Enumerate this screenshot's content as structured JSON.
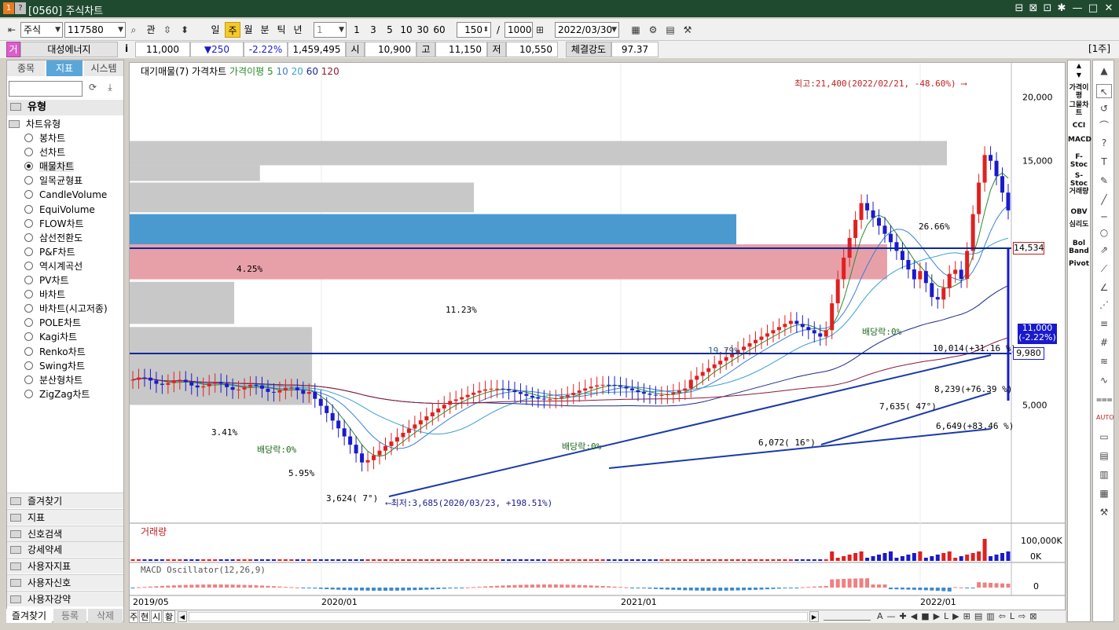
{
  "title_bar": {
    "icons": [
      "1",
      "?"
    ],
    "title": "[0560] 주식차트"
  },
  "toolbar": {
    "market": "주식",
    "code": "117580",
    "btn_gwan": "관",
    "periods": [
      "일",
      "주",
      "월",
      "분",
      "틱",
      "년"
    ],
    "active_period": "주",
    "interval_value": "1",
    "nums": [
      "1",
      "3",
      "5",
      "10",
      "30",
      "60"
    ],
    "count_value": "150",
    "slash": "/",
    "max_value": "1000",
    "date_value": "2022/03/30"
  },
  "quote": {
    "badge": "거",
    "name": "대성에너지",
    "info": "i",
    "price": "11,000",
    "change": "▼250",
    "rate": "-2.22%",
    "volume": "1,459,495",
    "open_label": "시",
    "open": "10,900",
    "high_label": "고",
    "high": "11,150",
    "low_label": "저",
    "low": "10,550",
    "strength_label": "체결강도",
    "strength": "97.37",
    "unit": "[1주]"
  },
  "left_panel": {
    "tabs": [
      "종목",
      "지표",
      "시스템"
    ],
    "active_tab": "지표",
    "section_title": "유형",
    "tree_root": "차트유형",
    "chart_types": [
      "봉차트",
      "선차트",
      "매물차트",
      "일목균형표",
      "CandleVolume",
      "EquiVolume",
      "FLOW차트",
      "삼선전환도",
      "P&F차트",
      "역시계곡선",
      "PV차트",
      "바차트",
      "바차트(시고저종)",
      "POLE차트",
      "Kagi차트",
      "Renko차트",
      "Swing차트",
      "분산형차트",
      "ZigZag차트"
    ],
    "selected_type": "매물차트",
    "sections": [
      "즐겨찾기",
      "지표",
      "신호검색",
      "강세약세",
      "사용자지표",
      "사용자신호",
      "사용자강약"
    ],
    "bottom_tabs": [
      "즐겨찾기",
      "등록",
      "삭제"
    ]
  },
  "chart": {
    "legend": {
      "vol_profile": "대기매물(7)",
      "price": "가격차트",
      "ma_title": "가격이평",
      "ma_periods": [
        "5",
        "10",
        "20",
        "60",
        "120"
      ],
      "ma_colors": [
        "#2d8a2d",
        "#3a7fd0",
        "#3aa0d0",
        "#1a2a8a",
        "#8a1a3a"
      ]
    },
    "y_ticks": [
      "20,000",
      "15,000",
      "5,000"
    ],
    "y_tick_values": [
      20000,
      15000,
      5000
    ],
    "y_range": [
      3000,
      22500
    ],
    "price_marker_high": "14,534",
    "price_marker_current": "11,000",
    "price_marker_current_rate": "(-2.22%)",
    "price_marker_low": "9,980",
    "annotations": {
      "max_note": "최고:21,400(2022/02/21, -48.60%)",
      "min_note": "최저:3,685(2020/03/23, +198.51%)",
      "dividend1": "배당락:0%",
      "dividend2": "배당락:0%",
      "dividend3": "배당락:0%",
      "low_mark": "3,624(  7°)",
      "mark_6072": "6,072( 16°)",
      "mark_7635": "7,635( 47°)",
      "mark_8239": "8,239(+76.39 %)",
      "mark_10014": "10,014(+31.16 %)",
      "mark_6649": "6,649(+83.46 %)"
    },
    "x_ticks": [
      "2019/05",
      "2020/01",
      "2021/01",
      "2022/01"
    ],
    "volume_title": "거래량",
    "volume_ticks": [
      "100,000K",
      "0K"
    ],
    "macd_title": "MACD Oscillator(12,26,9)",
    "macd_tick": "0",
    "colors": {
      "up": "#e02020",
      "down": "#1a1acc",
      "profile_gray": "#c8c8c8",
      "profile_blue": "#4a9ad0",
      "profile_red": "#e8a0a8"
    }
  },
  "chart_data": {
    "type": "bar",
    "title": "",
    "xlabel": "",
    "ylabel": "",
    "ylim": [
      3000,
      22500
    ],
    "categories": [
      "26.66%",
      "4.25%",
      "11.23%",
      "19.79%",
      "",
      "3.41%",
      "5.95%"
    ],
    "series": [
      {
        "name": "대기매물(7)",
        "values": [
          26.66,
          4.25,
          11.23,
          19.79,
          24.71,
          3.41,
          5.95
        ]
      }
    ],
    "price_bands": [
      [
        14700,
        16400
      ],
      [
        13700,
        14700
      ],
      [
        11900,
        13600
      ],
      [
        10300,
        11800
      ],
      [
        8800,
        10300
      ],
      [
        7200,
        8700
      ],
      [
        5000,
        7100
      ]
    ]
  },
  "right_bar": {
    "labels": [
      "가격이평",
      "그물차트",
      "CCI",
      "MACD",
      "F-Stoc",
      "S-Stoc",
      "거래량",
      "OBV",
      "심리도",
      "Bol Band",
      "Pivot"
    ]
  },
  "scroll": {
    "left_tabs": [
      "주",
      "현",
      "시",
      "황"
    ]
  }
}
